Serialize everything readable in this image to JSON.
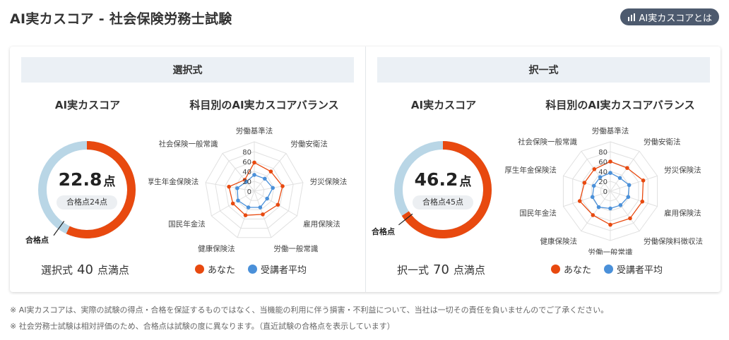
{
  "header": {
    "title": "AI実カスコア - 社会保険労務士試験",
    "about_button": "AI実カスコアとは",
    "about_icon": "bar-chart-icon"
  },
  "colors": {
    "you": "#e8490f",
    "average": "#4a90d9",
    "remaining": "#b9d6e6"
  },
  "panels": [
    {
      "heading": "選択式",
      "score_title": "AI実カスコア",
      "score": "22.8",
      "score_unit": "点",
      "pass_label": "合格点24点",
      "pass_mark_label": "合格点",
      "score_fraction": 0.57,
      "pass_fraction": 0.6,
      "full_prefix": "選択式",
      "full_value": "40",
      "full_suffix": "点満点",
      "radar_title": "科目別のAI実カスコアバランス",
      "legend_you": "あなた",
      "legend_avg": "受講者平均"
    },
    {
      "heading": "択一式",
      "score_title": "AI実カスコア",
      "score": "46.2",
      "score_unit": "点",
      "pass_label": "合格点45点",
      "pass_mark_label": "合格点",
      "score_fraction": 0.66,
      "pass_fraction": 0.643,
      "full_prefix": "択一式",
      "full_value": "70",
      "full_suffix": "点満点",
      "radar_title": "科目別のAI実カスコアバランス",
      "legend_you": "あなた",
      "legend_avg": "受講者平均"
    }
  ],
  "chart_data": [
    {
      "type": "radar",
      "ticks": [
        0,
        20,
        40,
        60,
        80
      ],
      "range": [
        0,
        100
      ],
      "categories": [
        "労働基準法",
        "労働安衛法",
        "労災保険法",
        "雇用保険法",
        "労働一般常識",
        "健康保険法",
        "国民年金法",
        "厚生年金保険法",
        "社会保険一般常識"
      ],
      "series": [
        {
          "name": "あなた",
          "values": [
            58,
            52,
            58,
            55,
            50,
            52,
            50,
            52,
            30
          ]
        },
        {
          "name": "受講者平均",
          "values": [
            33,
            33,
            38,
            30,
            35,
            35,
            38,
            35,
            25
          ]
        }
      ]
    },
    {
      "type": "radar",
      "ticks": [
        0,
        20,
        40,
        60,
        80
      ],
      "range": [
        0,
        100
      ],
      "categories": [
        "労働基準法",
        "労働安衛法",
        "労災保険法",
        "雇用保険法",
        "労働保険料徴収法",
        "労働一般常識",
        "健康保険法",
        "国民年金法",
        "厚生年金保険法",
        "社会保険一般常識"
      ],
      "series": [
        {
          "name": "あなた",
          "values": [
            60,
            58,
            70,
            68,
            68,
            68,
            60,
            65,
            55,
            55
          ]
        },
        {
          "name": "受講者平均",
          "values": [
            37,
            33,
            40,
            38,
            35,
            35,
            40,
            38,
            35,
            35
          ]
        }
      ]
    }
  ],
  "notes": [
    "※ AI実カスコアは、実際の試験の得点・合格を保証するものではなく、当機能の利用に伴う損害・不利益について、当社は一切その責任を負いませんのでご了承ください。",
    "※ 社会労務士試験は相対評価のため、合格点は試験の度に異なります。（直近試験の合格点を表示しています）"
  ]
}
